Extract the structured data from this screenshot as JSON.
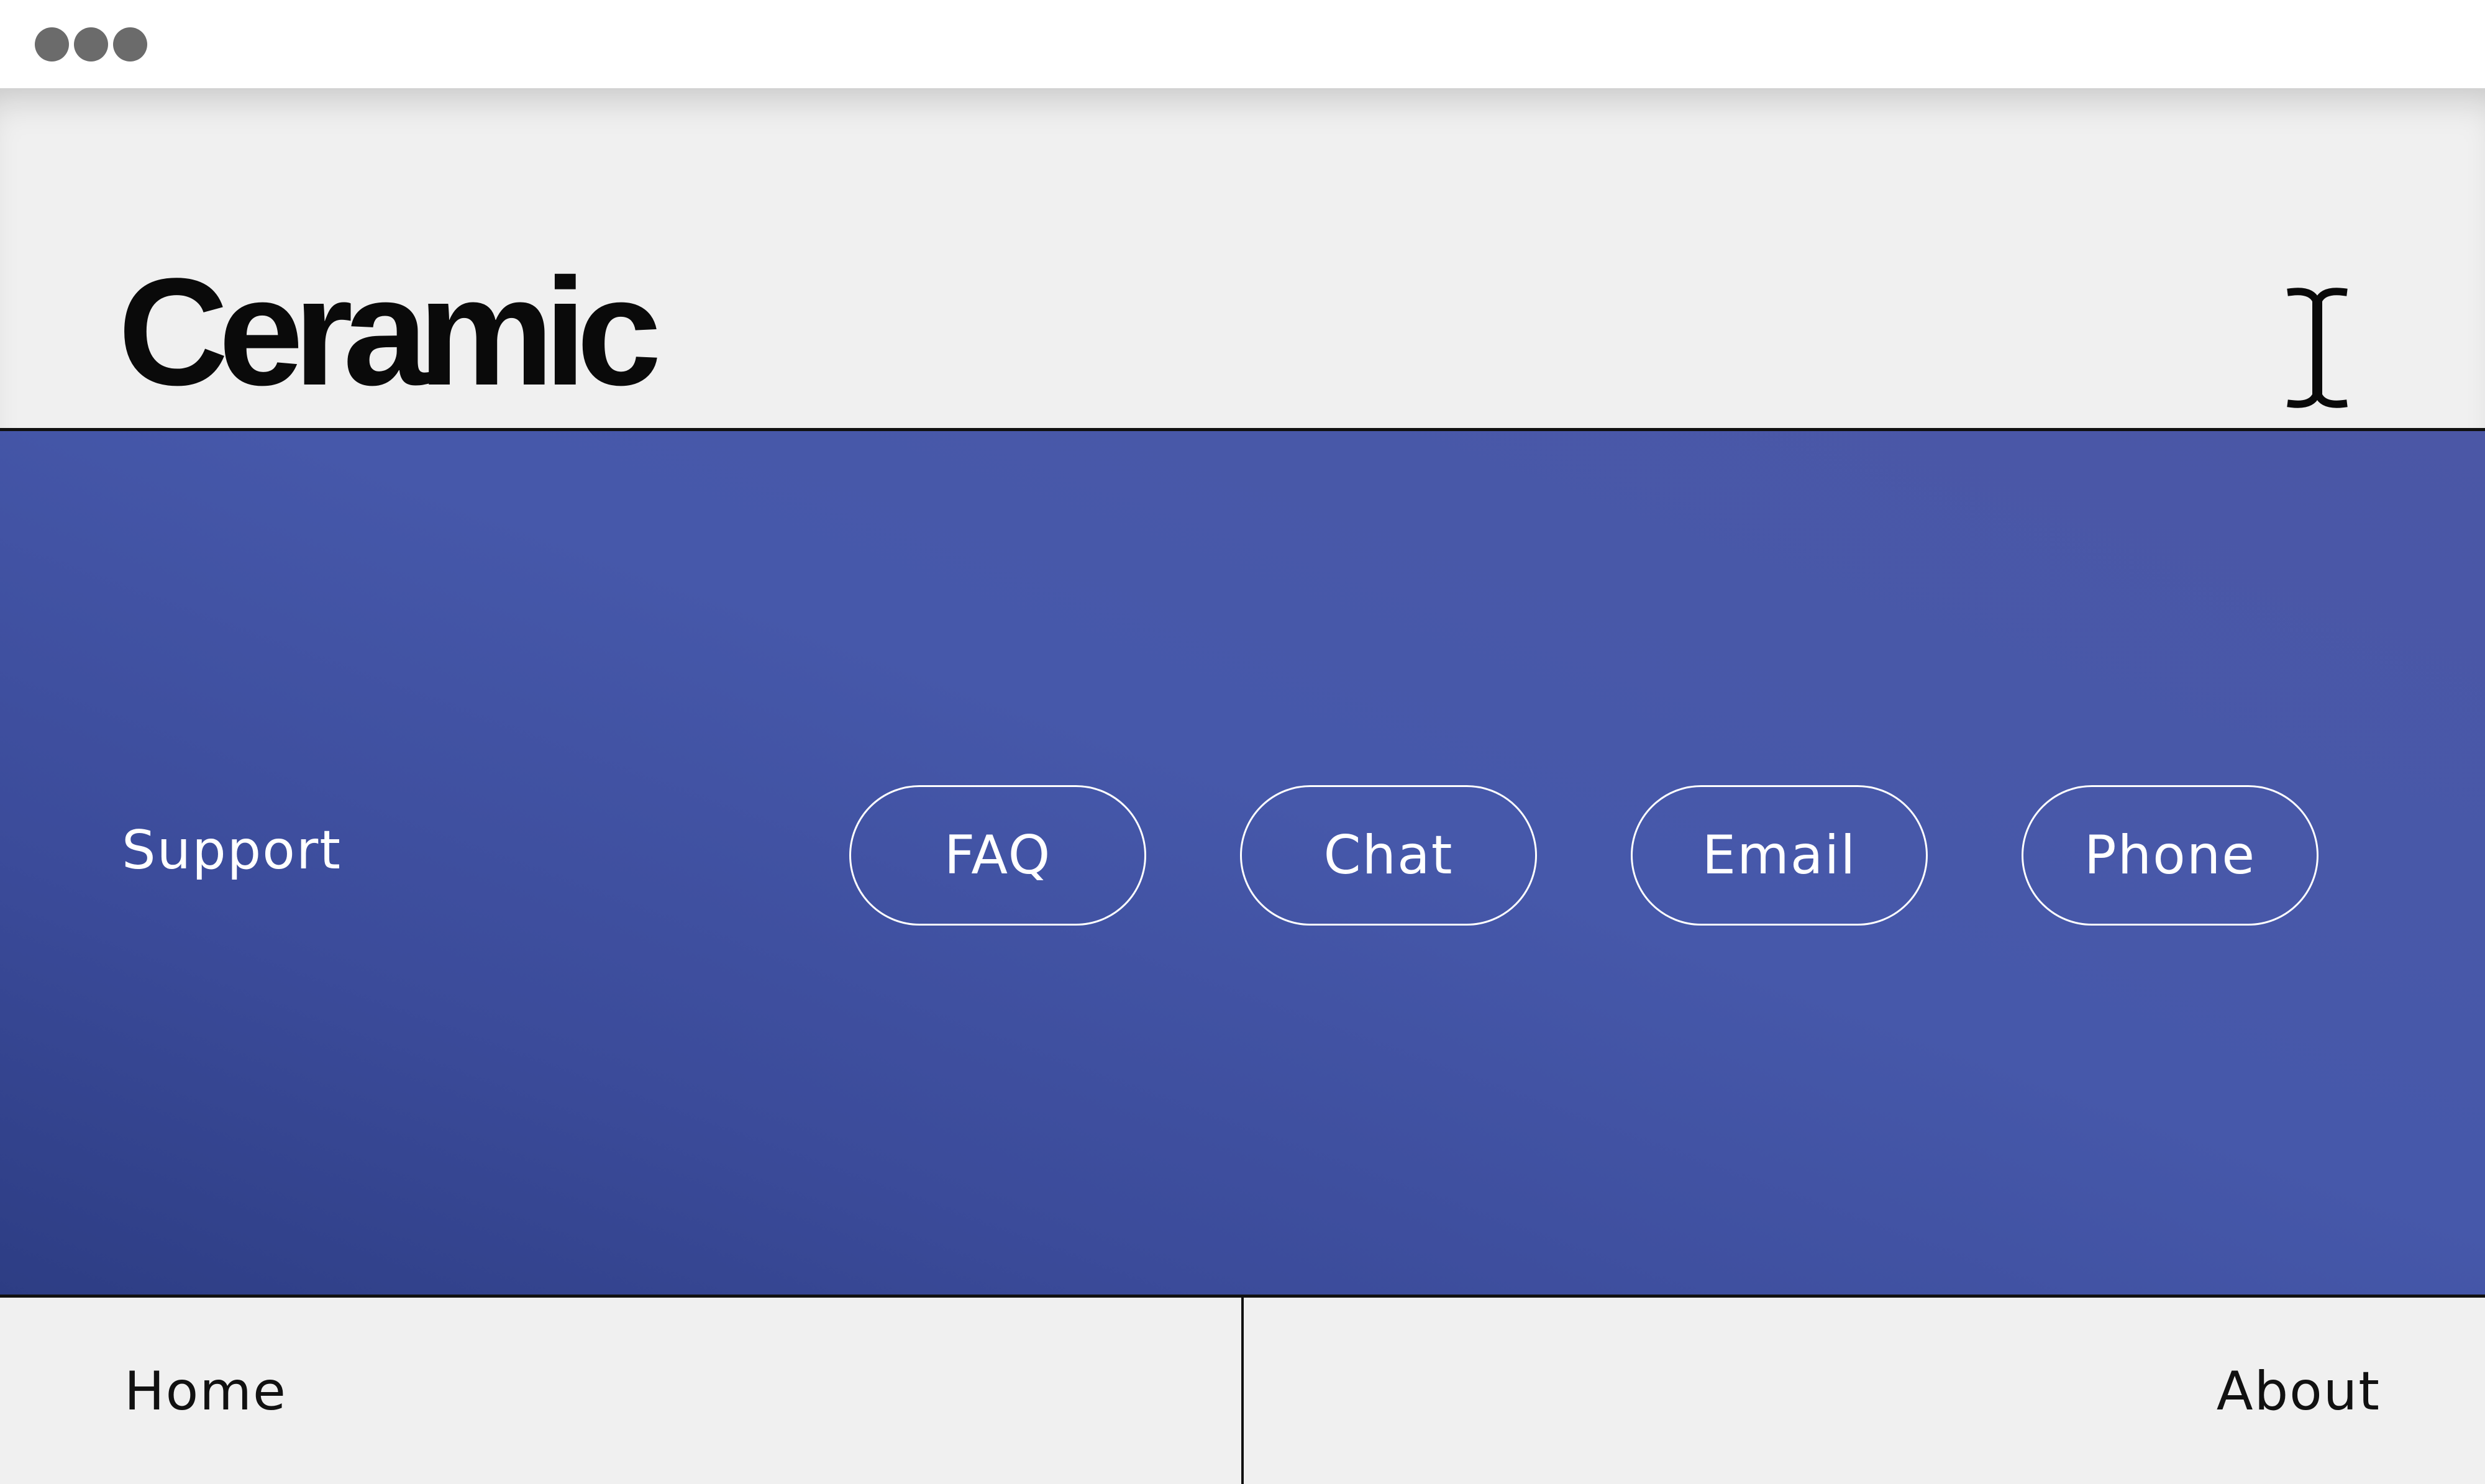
{
  "window": {
    "controls": [
      "dot",
      "dot",
      "dot"
    ]
  },
  "header": {
    "logo": "Ceramic",
    "cursor_icon": "text-cursor-icon"
  },
  "support": {
    "label": "Support",
    "buttons": [
      {
        "label": "FAQ"
      },
      {
        "label": "Chat"
      },
      {
        "label": "Email"
      },
      {
        "label": "Phone"
      }
    ]
  },
  "footer": {
    "home_label": "Home",
    "about_label": "About"
  },
  "colors": {
    "band_gradient": [
      "#2d3d84",
      "#4658aa",
      "#4b57a6"
    ],
    "page_background": "#f0f0f0",
    "text_dark": "#111111",
    "text_light": "#ffffff"
  }
}
